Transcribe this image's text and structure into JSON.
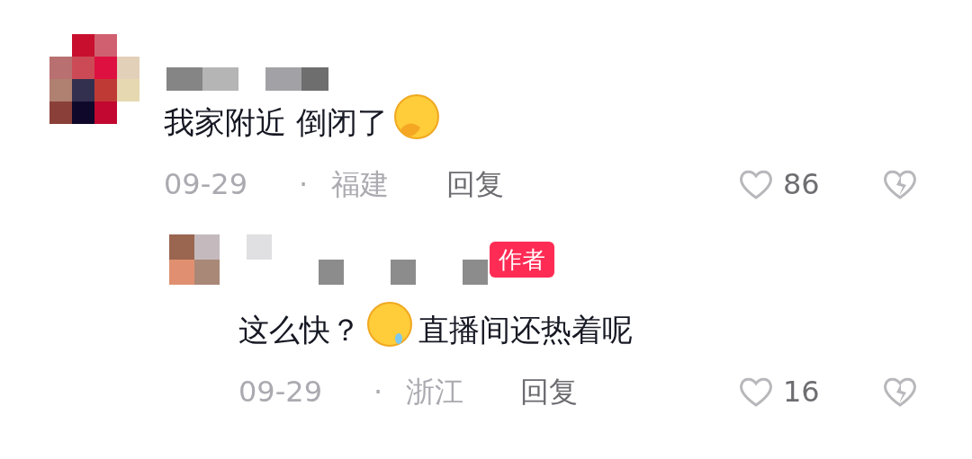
{
  "comments": [
    {
      "text": "我家附近 倒闭了",
      "date": "09-29",
      "separator": "·",
      "region": "福建",
      "reply": "回复",
      "likes": "86",
      "replies": [
        {
          "text": "这么快？",
          "text_after": "直播间还热着呢",
          "author_badge": "作者",
          "date": "09-29",
          "separator": "·",
          "region": "浙江",
          "reply": "回复",
          "likes": "16"
        }
      ]
    }
  ]
}
